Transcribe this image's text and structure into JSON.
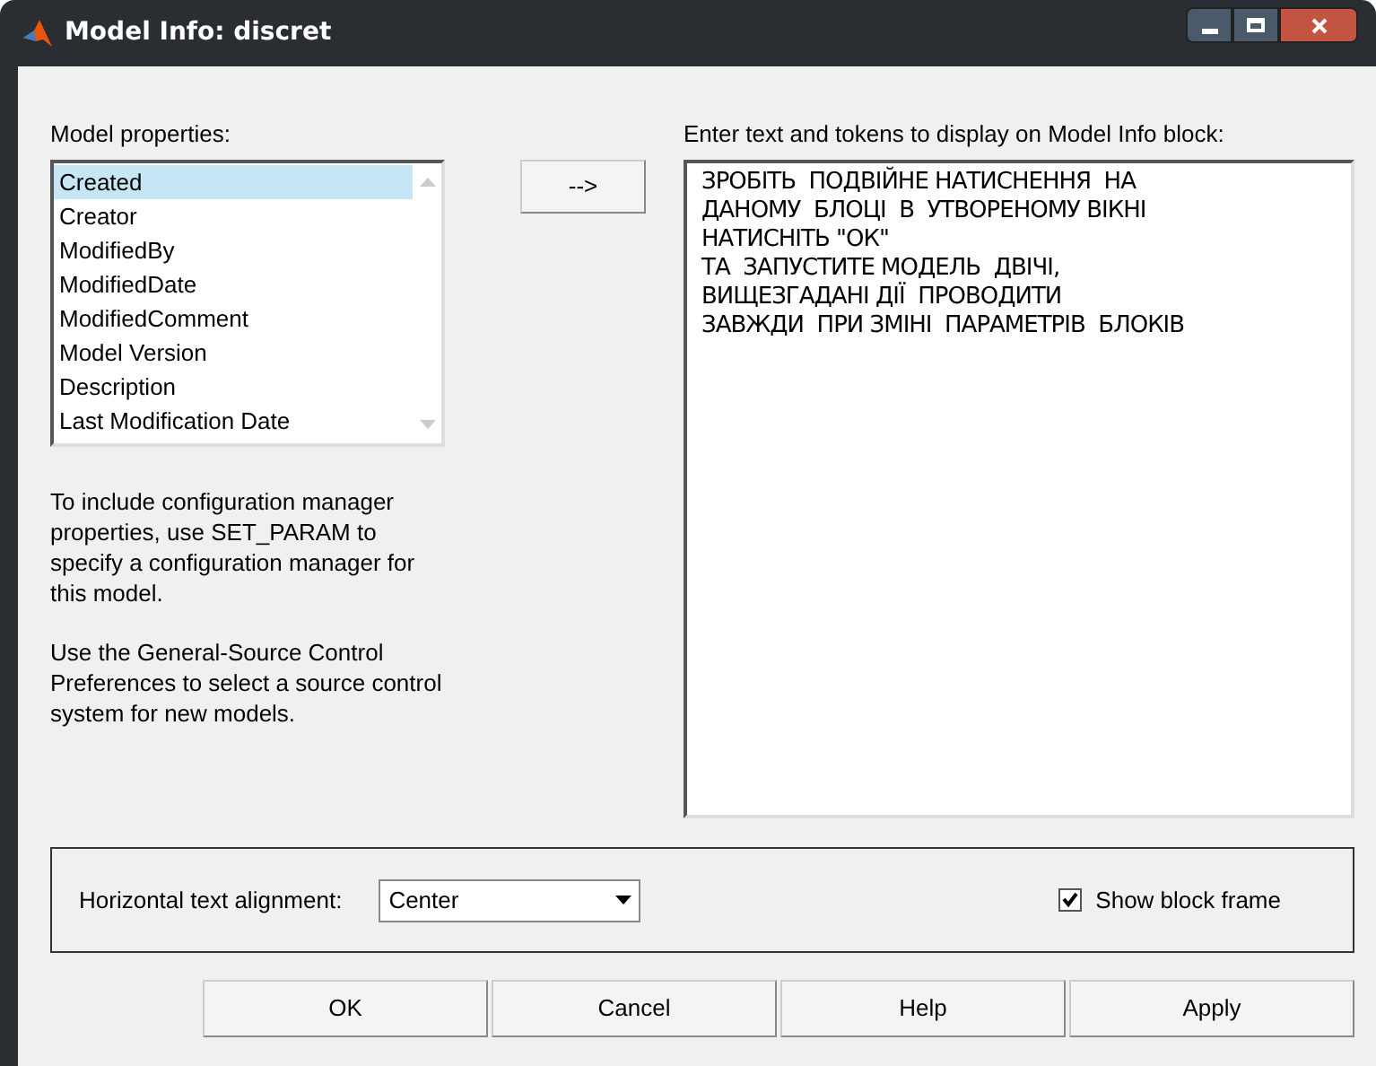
{
  "window": {
    "title": "Model Info: discret"
  },
  "properties": {
    "label": "Model properties:",
    "items": [
      {
        "label": "Created",
        "selected": true
      },
      {
        "label": "Creator",
        "selected": false
      },
      {
        "label": "ModifiedBy",
        "selected": false
      },
      {
        "label": "ModifiedDate",
        "selected": false
      },
      {
        "label": "ModifiedComment",
        "selected": false
      },
      {
        "label": "Model Version",
        "selected": false
      },
      {
        "label": "Description",
        "selected": false
      },
      {
        "label": "Last Modification Date",
        "selected": false
      }
    ]
  },
  "insert_button": "-->",
  "text_area": {
    "label": "Enter text and tokens to display on Model Info block:",
    "value": "ЗРОБІТЬ  ПОДВІЙНЕ НАТИСНЕННЯ  НА\nДАНОМУ  БЛОЦІ  В  УТВОРЕНОМУ ВІКНІ\nНАТИСНІТЬ \"ОК\"\nТА  ЗАПУСТИТЕ МОДЕЛЬ  ДВІЧІ,\nВИЩЕЗГАДАНІ ДІЇ  ПРОВОДИТИ\nЗАВЖДИ  ПРИ ЗМІНІ  ПАРАМЕТРІВ  БЛОКІВ"
  },
  "notes": [
    "To include configuration manager properties, use SET_PARAM to specify a configuration manager for this model.",
    "Use the General-Source Control Preferences to select a source control system for new models."
  ],
  "alignment": {
    "label": "Horizontal text alignment:",
    "value": "Center"
  },
  "show_frame": {
    "label": "Show block frame",
    "checked": true
  },
  "buttons": [
    "OK",
    "Cancel",
    "Help",
    "Apply"
  ]
}
